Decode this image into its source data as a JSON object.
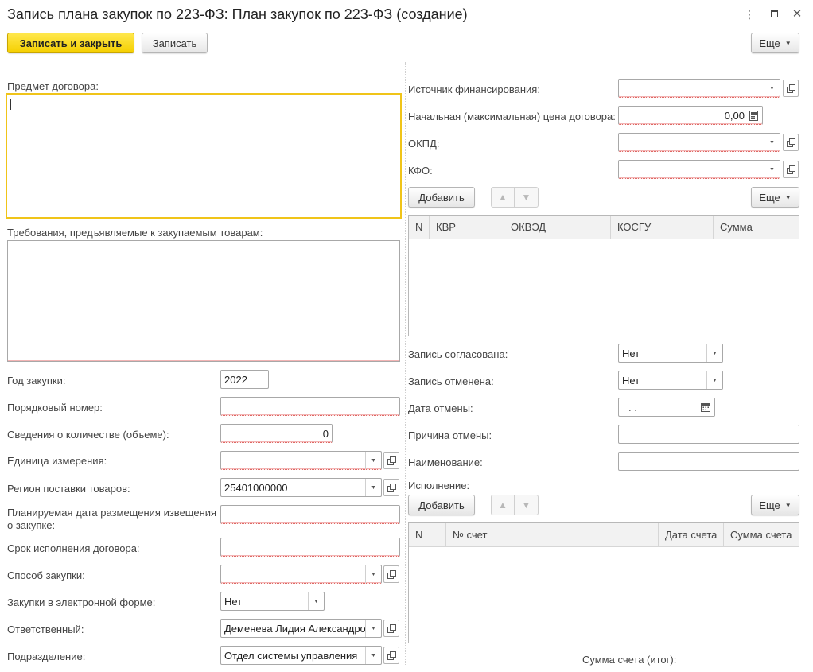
{
  "window": {
    "title": "Запись плана закупок по 223-ФЗ: План закупок по 223-ФЗ (создание)"
  },
  "toolbar": {
    "save_close_label": "Записать и закрыть",
    "save_label": "Записать",
    "more_label": "Еще"
  },
  "left": {
    "subject_label": "Предмет договора:",
    "subject_value": "",
    "requirements_label": "Требования, предъявляемые к закупаемым товарам:",
    "requirements_value": "",
    "fields": {
      "year": {
        "label": "Год закупки:",
        "value": "2022"
      },
      "serial": {
        "label": "Порядковый номер:",
        "value": ""
      },
      "quantity": {
        "label": "Сведения о количестве (объеме):",
        "value": "0"
      },
      "unit": {
        "label": "Единица измерения:",
        "value": ""
      },
      "region": {
        "label": "Регион поставки товаров:",
        "value": "25401000000"
      },
      "notice_date": {
        "label_line1": "Планируемая дата размещения извещения",
        "label_line2": "о закупке:",
        "value": ""
      },
      "term": {
        "label": "Срок исполнения договора:",
        "value": ""
      },
      "method": {
        "label": "Способ закупки:",
        "value": ""
      },
      "electronic": {
        "label": "Закупки в электронной форме:",
        "value": "Нет"
      },
      "responsible": {
        "label": "Ответственный:",
        "value": "Деменева Лидия Александро"
      },
      "department": {
        "label": "Подразделение:",
        "value": "Отдел системы управления"
      }
    }
  },
  "right": {
    "fields": {
      "source": {
        "label": "Источник финансирования:",
        "value": ""
      },
      "price": {
        "label": "Начальная (максимальная) цена договора:",
        "value": "0,00"
      },
      "okpd": {
        "label": "ОКПД:",
        "value": ""
      },
      "kfo": {
        "label": "КФО:",
        "value": ""
      },
      "approved": {
        "label": "Запись согласована:",
        "value": "Нет"
      },
      "cancelled": {
        "label": "Запись отменена:",
        "value": "Нет"
      },
      "cancel_date": {
        "label": "Дата отмены:",
        "value": " .  ."
      },
      "cancel_reason": {
        "label": "Причина отмены:",
        "value": ""
      },
      "name": {
        "label": "Наименование:",
        "value": ""
      }
    },
    "add_label": "Добавить",
    "more_label": "Еще",
    "table1": {
      "columns": [
        "N",
        "КВР",
        "ОКВЭД",
        "КОСГУ",
        "Сумма"
      ]
    },
    "execution_label": "Исполнение:",
    "table2": {
      "columns": [
        "N",
        "№ счет",
        "Дата счета",
        "Сумма счета"
      ]
    },
    "total_label": "Сумма счета (итог):"
  },
  "icons": {
    "more_menu": "kebab-icon",
    "maximize": "maximize-icon",
    "close": "close-icon",
    "dropdown": "chevron-down-icon",
    "open": "open-form-icon",
    "calendar": "calendar-icon",
    "calculator": "calculator-icon",
    "move_up": "arrow-up-icon",
    "move_down": "arrow-down-icon"
  },
  "colors": {
    "primary_button": "#f5cf00",
    "focus_border": "#f0c419",
    "required_underline": "#d9534f"
  }
}
